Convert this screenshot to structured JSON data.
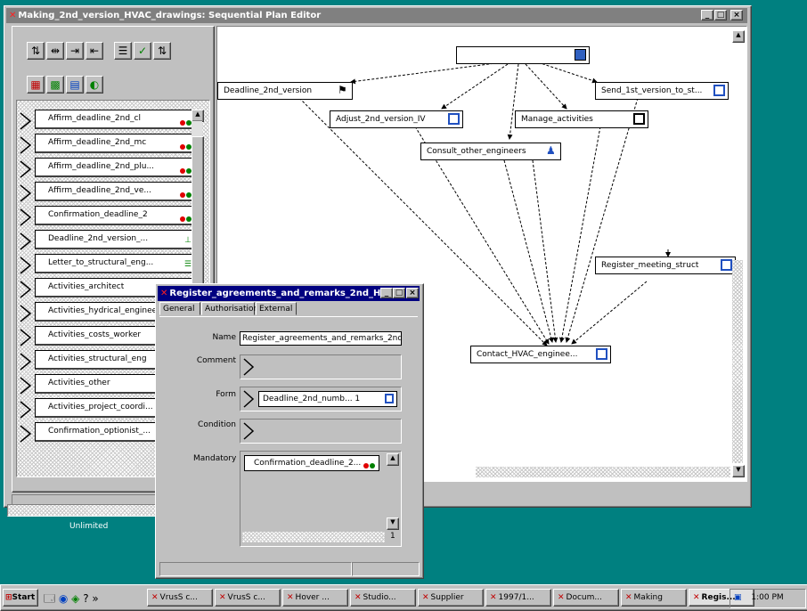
{
  "main_window": {
    "title": "Making_2nd_version_HVAC_drawings: Sequential Plan Editor",
    "controls": [
      "_",
      "□",
      "×"
    ]
  },
  "left_panel": {
    "items": [
      {
        "label": "Affirm_deadline_2nd_cl",
        "status": "red-green"
      },
      {
        "label": "Affirm_deadline_2nd_mc",
        "status": "red-green"
      },
      {
        "label": "Affirm_deadline_2nd_plu...",
        "status": "red-green"
      },
      {
        "label": "Affirm_deadline_2nd_ve...",
        "status": "red-green"
      },
      {
        "label": "Confirmation_deadline_2",
        "status": "red-green"
      },
      {
        "label": "Deadline_2nd_version_...",
        "status": "chart"
      },
      {
        "label": "Letter_to_structural_eng...",
        "status": "list"
      },
      {
        "label": "Activities_architect",
        "status": ""
      },
      {
        "label": "Activities_hydrical_engineer",
        "status": ""
      },
      {
        "label": "Activities_costs_worker",
        "status": ""
      },
      {
        "label": "Activities_structural_eng",
        "status": ""
      },
      {
        "label": "Activities_other",
        "status": ""
      },
      {
        "label": "Activities_project_coordi...",
        "status": ""
      },
      {
        "label": "Confirmation_optionist_...",
        "status": ""
      }
    ],
    "status_text": "Unlimited"
  },
  "canvas": {
    "nodes": {
      "top": "",
      "deadline": "Deadline_2nd_version",
      "adjust": "Adjust_2nd_version_IV",
      "manage": "Manage_activities",
      "send": "Send_1st_version_to_st...",
      "consult": "Consult_other_engineers",
      "register": "Register_meeting_struct",
      "contact": "Contact_HVAC_enginee..."
    }
  },
  "dialog": {
    "title": "Register_agreements_and_remarks_2nd_H...",
    "tabs": [
      "General",
      "Authorisation",
      "External"
    ],
    "name_label": "Name",
    "name_value": "Register_agreements_and_remarks_2nd_",
    "comment_label": "Comment",
    "form_label": "Form",
    "form_value": "Deadline_2nd_numb... 1",
    "condition_label": "Condition",
    "mandatory_label": "Mandatory",
    "mandatory_item": "Confirmation_deadline_2...",
    "count": "1"
  },
  "taskbar": {
    "start": "Start",
    "buttons": [
      "VrusS c...",
      "VrusS c...",
      "Hover ...",
      "Studio...",
      "Supplier",
      "1997/1...",
      "Docum...",
      "Making",
      "Regis..."
    ],
    "clock": "1:00 PM"
  },
  "colors": {
    "desktop": "#008080",
    "title_active": "#000080",
    "title_inactive": "#808080",
    "accent_red": "#e00000",
    "accent_green": "#008000"
  }
}
